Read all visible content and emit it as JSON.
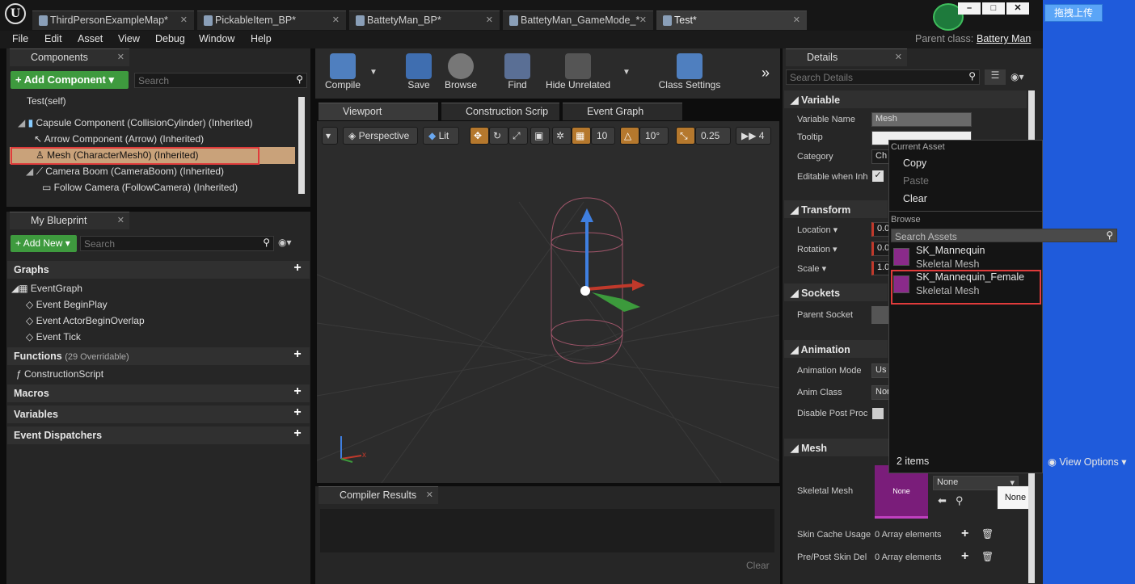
{
  "doc_tabs": [
    {
      "label": "ThirdPersonExampleMap*",
      "active": false
    },
    {
      "label": "PickableItem_BP*",
      "active": false
    },
    {
      "label": "BattetyMan_BP*",
      "active": false
    },
    {
      "label": "BattetyMan_GameMode_*",
      "active": false
    },
    {
      "label": "Test*",
      "active": true
    }
  ],
  "menu": [
    "File",
    "Edit",
    "Asset",
    "View",
    "Debug",
    "Window",
    "Help"
  ],
  "parent_class": {
    "label": "Parent class:",
    "value": "Battery Man"
  },
  "upload_button": "拖拽上传",
  "components": {
    "tab": "Components",
    "add_button": "Add Component",
    "search_placeholder": "Search",
    "tree": [
      {
        "label": "Test(self)",
        "indent": 0
      },
      {
        "label": "Capsule Component (CollisionCylinder) (Inherited)",
        "indent": 1
      },
      {
        "label": "Arrow Component (Arrow) (Inherited)",
        "indent": 2
      },
      {
        "label": "Mesh (CharacterMesh0) (Inherited)",
        "indent": 2,
        "selected": true
      },
      {
        "label": "Camera Boom (CameraBoom) (Inherited)",
        "indent": 1
      },
      {
        "label": "Follow Camera (FollowCamera) (Inherited)",
        "indent": 2
      }
    ]
  },
  "my_blueprint": {
    "tab": "My Blueprint",
    "add_button": "Add New",
    "search_placeholder": "Search",
    "graphs_label": "Graphs",
    "event_graph": "EventGraph",
    "events": [
      "Event BeginPlay",
      "Event ActorBeginOverlap",
      "Event Tick"
    ],
    "functions_label": "Functions",
    "functions_count": "(29 Overridable)",
    "construction_script": "ConstructionScript",
    "macros": "Macros",
    "variables": "Variables",
    "event_dispatchers": "Event Dispatchers"
  },
  "toolbar": {
    "compile": "Compile",
    "save": "Save",
    "browse": "Browse",
    "find": "Find",
    "hide_unrelated": "Hide Unrelated",
    "class_settings": "Class Settings"
  },
  "editor_tabs": [
    "Viewport",
    "Construction Scrip",
    "Event Graph"
  ],
  "viewport": {
    "perspective": "Perspective",
    "lit": "Lit",
    "grid": "10",
    "rot": "10°",
    "scale": "0.25",
    "speed": "4"
  },
  "compiler": {
    "tab": "Compiler Results",
    "clear": "Clear"
  },
  "details": {
    "tab": "Details",
    "search_placeholder": "Search Details",
    "variable": {
      "header": "Variable",
      "name_label": "Variable Name",
      "name_value": "Mesh",
      "tooltip_label": "Tooltip",
      "category_label": "Category",
      "category_value": "Ch",
      "editable_label": "Editable when Inh"
    },
    "transform": {
      "header": "Transform",
      "location": "Location",
      "rotation": "Rotation",
      "scale": "Scale",
      "loc_val": "0.0",
      "rot_val": "0.0",
      "scale_val": "1.0"
    },
    "sockets": {
      "header": "Sockets",
      "parent_socket": "Parent Socket"
    },
    "animation": {
      "header": "Animation",
      "mode_label": "Animation Mode",
      "mode_val": "Us",
      "class_label": "Anim Class",
      "class_val": "Non",
      "disable_label": "Disable Post Proc"
    },
    "mesh": {
      "header": "Mesh",
      "skeletal_label": "Skeletal Mesh",
      "thumb_text": "None",
      "combo_value": "None",
      "tooltip": "None",
      "skin_cache_label": "Skin Cache Usage",
      "skin_cache_val": "0 Array elements",
      "prepost_label": "Pre/Post Skin Del",
      "prepost_val": "0 Array elements"
    }
  },
  "asset_menu": {
    "current_asset": "Current Asset",
    "copy": "Copy",
    "paste": "Paste",
    "clear": "Clear",
    "browse": "Browse",
    "search_placeholder": "Search Assets",
    "assets": [
      {
        "name": "SK_Mannequin",
        "type": "Skeletal Mesh"
      },
      {
        "name": "SK_Mannequin_Female",
        "type": "Skeletal Mesh"
      }
    ],
    "count": "2 items",
    "view_options": "View Options"
  }
}
